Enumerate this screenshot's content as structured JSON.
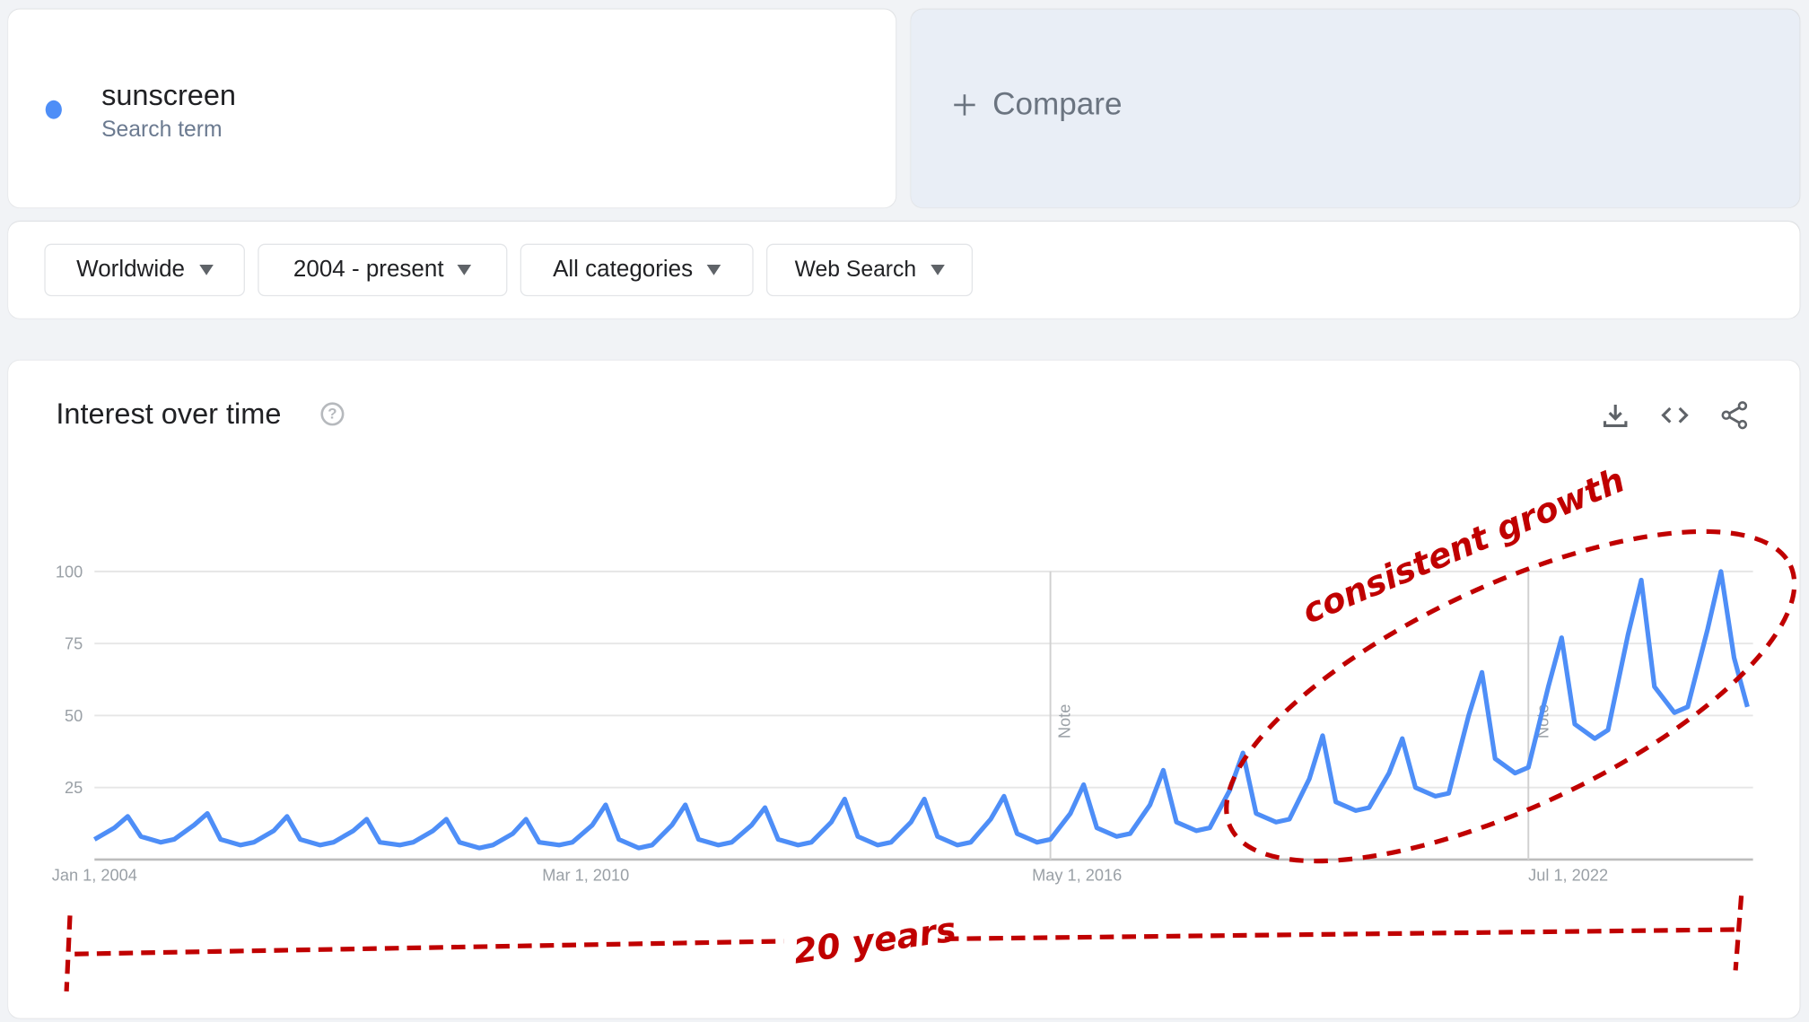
{
  "term": {
    "name": "sunscreen",
    "type": "Search term",
    "color": "#4e8ef7"
  },
  "compare": {
    "label": "Compare",
    "icon": "plus-icon"
  },
  "filters": [
    {
      "label": "Worldwide"
    },
    {
      "label": "2004 - present"
    },
    {
      "label": "All categories"
    },
    {
      "label": "Web Search"
    }
  ],
  "chart_card": {
    "title": "Interest over time",
    "help_icon": "?",
    "actions": [
      "download-icon",
      "embed-code-icon",
      "share-icon"
    ]
  },
  "annotations": {
    "growth": "consistent growth",
    "span": "20 years",
    "color": "#c00000"
  },
  "chart_data": {
    "type": "line",
    "title": "Interest over time",
    "ylim": [
      0,
      100
    ],
    "yticks": [
      "100",
      "75",
      "50",
      "25"
    ],
    "xticks": [
      {
        "label": "Jan 1, 2004",
        "date": "2004-01"
      },
      {
        "label": "Mar 1, 2010",
        "date": "2010-03"
      },
      {
        "label": "May 1, 2016",
        "date": "2016-05"
      },
      {
        "label": "Jul 1, 2022",
        "date": "2022-07"
      }
    ],
    "notes": [
      {
        "label": "Note",
        "date": "2016-01"
      },
      {
        "label": "Note",
        "date": "2022-01"
      }
    ],
    "grid": true,
    "series": [
      {
        "name": "sunscreen",
        "color": "#4e8ef7",
        "points": [
          [
            "2004-01",
            7
          ],
          [
            "2004-04",
            11
          ],
          [
            "2004-06",
            15
          ],
          [
            "2004-08",
            8
          ],
          [
            "2004-11",
            6
          ],
          [
            "2005-01",
            7
          ],
          [
            "2005-04",
            12
          ],
          [
            "2005-06",
            16
          ],
          [
            "2005-08",
            7
          ],
          [
            "2005-11",
            5
          ],
          [
            "2006-01",
            6
          ],
          [
            "2006-04",
            10
          ],
          [
            "2006-06",
            15
          ],
          [
            "2006-08",
            7
          ],
          [
            "2006-11",
            5
          ],
          [
            "2007-01",
            6
          ],
          [
            "2007-04",
            10
          ],
          [
            "2007-06",
            14
          ],
          [
            "2007-08",
            6
          ],
          [
            "2007-11",
            5
          ],
          [
            "2008-01",
            6
          ],
          [
            "2008-04",
            10
          ],
          [
            "2008-06",
            14
          ],
          [
            "2008-08",
            6
          ],
          [
            "2008-11",
            4
          ],
          [
            "2009-01",
            5
          ],
          [
            "2009-04",
            9
          ],
          [
            "2009-06",
            14
          ],
          [
            "2009-08",
            6
          ],
          [
            "2009-11",
            5
          ],
          [
            "2010-01",
            6
          ],
          [
            "2010-04",
            12
          ],
          [
            "2010-06",
            19
          ],
          [
            "2010-08",
            7
          ],
          [
            "2010-11",
            4
          ],
          [
            "2011-01",
            5
          ],
          [
            "2011-04",
            12
          ],
          [
            "2011-06",
            19
          ],
          [
            "2011-08",
            7
          ],
          [
            "2011-11",
            5
          ],
          [
            "2012-01",
            6
          ],
          [
            "2012-04",
            12
          ],
          [
            "2012-06",
            18
          ],
          [
            "2012-08",
            7
          ],
          [
            "2012-11",
            5
          ],
          [
            "2013-01",
            6
          ],
          [
            "2013-04",
            13
          ],
          [
            "2013-06",
            21
          ],
          [
            "2013-08",
            8
          ],
          [
            "2013-11",
            5
          ],
          [
            "2014-01",
            6
          ],
          [
            "2014-04",
            13
          ],
          [
            "2014-06",
            21
          ],
          [
            "2014-08",
            8
          ],
          [
            "2014-11",
            5
          ],
          [
            "2015-01",
            6
          ],
          [
            "2015-04",
            14
          ],
          [
            "2015-06",
            22
          ],
          [
            "2015-08",
            9
          ],
          [
            "2015-11",
            6
          ],
          [
            "2016-01",
            7
          ],
          [
            "2016-04",
            16
          ],
          [
            "2016-06",
            26
          ],
          [
            "2016-08",
            11
          ],
          [
            "2016-11",
            8
          ],
          [
            "2017-01",
            9
          ],
          [
            "2017-04",
            19
          ],
          [
            "2017-06",
            31
          ],
          [
            "2017-08",
            13
          ],
          [
            "2017-11",
            10
          ],
          [
            "2018-01",
            11
          ],
          [
            "2018-04",
            24
          ],
          [
            "2018-06",
            37
          ],
          [
            "2018-08",
            16
          ],
          [
            "2018-11",
            13
          ],
          [
            "2019-01",
            14
          ],
          [
            "2019-04",
            28
          ],
          [
            "2019-06",
            43
          ],
          [
            "2019-08",
            20
          ],
          [
            "2019-11",
            17
          ],
          [
            "2020-01",
            18
          ],
          [
            "2020-04",
            30
          ],
          [
            "2020-06",
            42
          ],
          [
            "2020-08",
            25
          ],
          [
            "2020-11",
            22
          ],
          [
            "2021-01",
            23
          ],
          [
            "2021-04",
            50
          ],
          [
            "2021-06",
            65
          ],
          [
            "2021-08",
            35
          ],
          [
            "2021-11",
            30
          ],
          [
            "2022-01",
            32
          ],
          [
            "2022-04",
            60
          ],
          [
            "2022-06",
            77
          ],
          [
            "2022-08",
            47
          ],
          [
            "2022-11",
            42
          ],
          [
            "2023-01",
            45
          ],
          [
            "2023-04",
            78
          ],
          [
            "2023-06",
            97
          ],
          [
            "2023-08",
            60
          ],
          [
            "2023-11",
            51
          ],
          [
            "2024-01",
            53
          ],
          [
            "2024-04",
            80
          ],
          [
            "2024-06",
            100
          ],
          [
            "2024-08",
            70
          ],
          [
            "2024-10",
            53
          ]
        ]
      }
    ]
  }
}
